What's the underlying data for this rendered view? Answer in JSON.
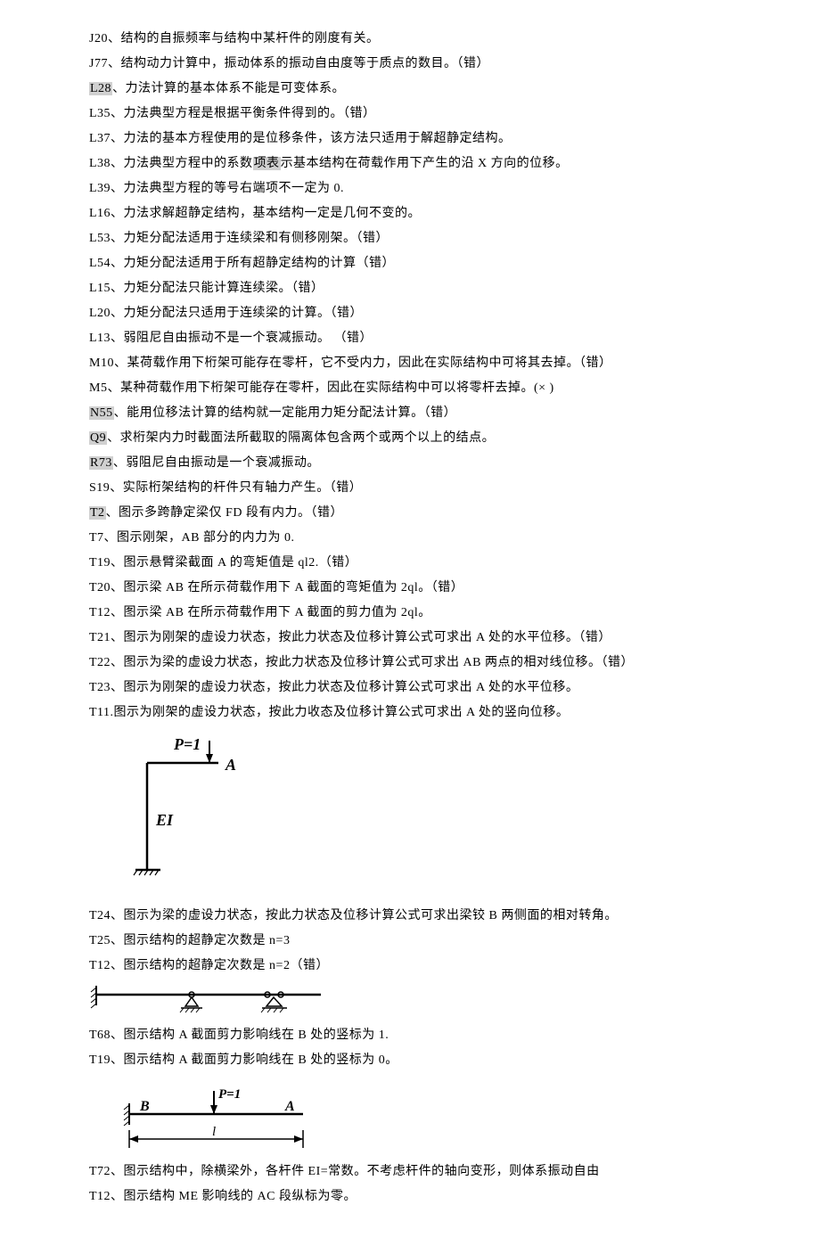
{
  "lines": {
    "l1": "J20、结构的自振频率与结构中某杆件的刚度有关。",
    "l2": "J77、结构动力计算中，振动体系的振动自由度等于质点的数目。（错）",
    "l3a": "L28",
    "l3b": "、力法计算的基本体系不能是可变体系。",
    "l4": "L35、力法典型方程是根据平衡条件得到的。（错）",
    "l5": "L37、力法的基本方程使用的是位移条件，该方法只适用于解超静定结构。",
    "l6a": "L38、力法典型方程中的系数",
    "l6b": "项表",
    "l6c": "示基本结构在荷载作用下产生的沿 X 方向的位移。",
    "l7": "L39、力法典型方程的等号右端项不一定为 0.",
    "l8": "L16、力法求解超静定结构，基本结构一定是几何不变的。",
    "l9": "L53、力矩分配法适用于连续梁和有侧移刚架。（错）",
    "l10": "L54、力矩分配法适用于所有超静定结构的计算（错）",
    "l11": "L15、力矩分配法只能计算连续梁。（错）",
    "l12": "L20、力矩分配法只适用于连续梁的计算。（错）",
    "l13": "L13、弱阻尼自由振动不是一个衰减振动。 （错）",
    "l14": "M10、某荷载作用下桁架可能存在零杆，它不受内力，因此在实际结构中可将其去掉。（错）",
    "l15": "M5、某种荷载作用下桁架可能存在零杆，因此在实际结构中可以将零杆去掉。(× )",
    "l16a": "N55",
    "l16b": "、能用位移法计算的结构就一定能用力矩分配法计算。（错）",
    "l17a": "Q9",
    "l17b": "、求桁架内力时截面法所截取的隔离体包含两个或两个以上的结点。",
    "l18a": "R73",
    "l18b": "、弱阻尼自由振动是一个衰减振动。",
    "l19": "S19、实际桁架结构的杆件只有轴力产生。（错）",
    "l20a": "T2",
    "l20b": "、图示多跨静定梁仅 FD 段有内力。（错）",
    "l21": "T7、图示刚架，AB 部分的内力为 0.",
    "l22": "T19、图示悬臂梁截面 A 的弯矩值是 ql2.（错）",
    "l23": "T20、图示梁 AB 在所示荷载作用下 A 截面的弯矩值为 2ql。（错）",
    "l24": "T12、图示梁 AB 在所示荷载作用下 A 截面的剪力值为 2ql。",
    "l25": "T21、图示为刚架的虚设力状态，按此力状态及位移计算公式可求出 A 处的水平位移。（错）",
    "l26": "T22、图示为梁的虚设力状态，按此力状态及位移计算公式可求出 AB 两点的相对线位移。（错）",
    "l27": "T23、图示为刚架的虚设力状态，按此力状态及位移计算公式可求出 A 处的水平位移。",
    "l28": "T11.图示为刚架的虚设力状态，按此力收态及位移计算公式可求出 A 处的竖向位移。",
    "l29": "T24、图示为梁的虚设力状态，按此力状态及位移计算公式可求出梁铰 B 两侧面的相对转角。",
    "l30": "T25、图示结构的超静定次数是 n=3",
    "l31": "T12、图示结构的超静定次数是 n=2（错）",
    "l32": "T68、图示结构 A 截面剪力影响线在 B 处的竖标为 1.",
    "l33": "T19、图示结构 A 截面剪力影响线在 B 处的竖标为 0。",
    "l34": "T72、图示结构中，除横梁外，各杆件 EI=常数。不考虑杆件的轴向变形，则体系振动自由",
    "l35": "T12、图示结构 ME 影响线的 AC 段纵标为零。"
  },
  "fig1": {
    "P": "P=1",
    "A": "A",
    "EI": "EI"
  },
  "fig3": {
    "B": "B",
    "A": "A",
    "P": "P=1",
    "l": "l"
  }
}
